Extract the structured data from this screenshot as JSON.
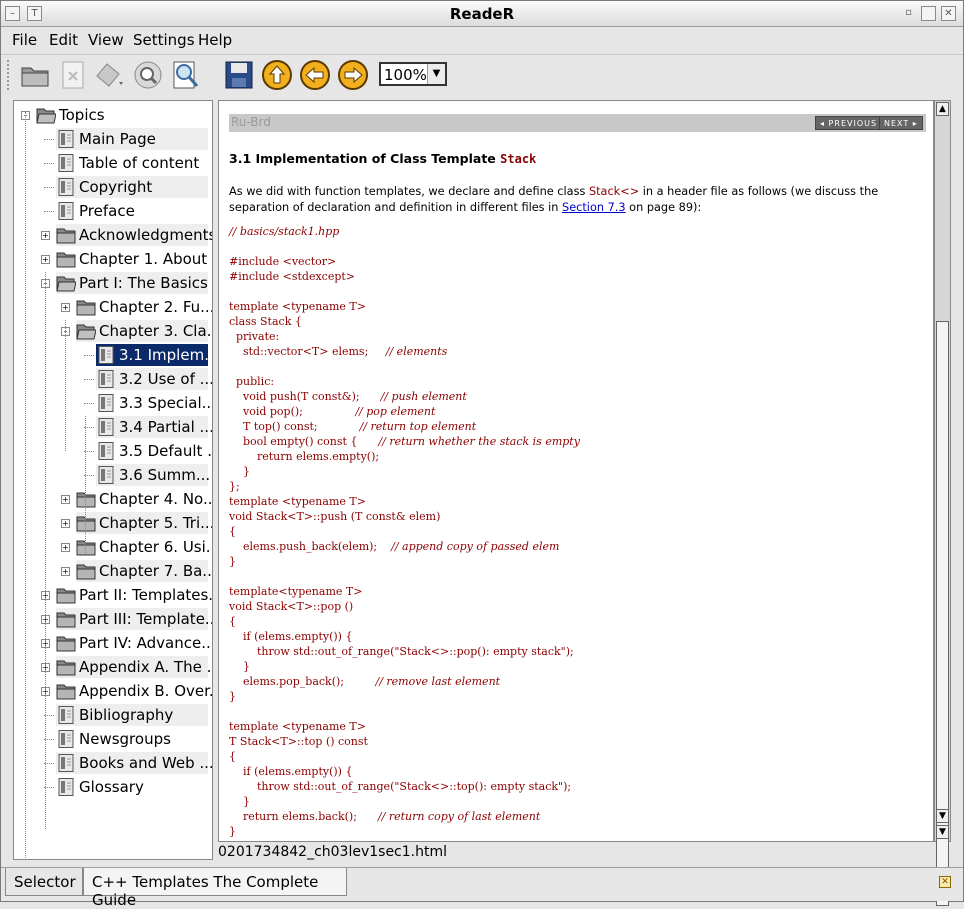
{
  "window": {
    "title": "ReadeR"
  },
  "menu": [
    "File",
    "Edit",
    "View",
    "Settings",
    "Help"
  ],
  "toolbar": {
    "zoom": "100%"
  },
  "tree": [
    {
      "label": "Topics",
      "depth": 0,
      "type": "folder-open",
      "exp": "-"
    },
    {
      "label": "Main Page",
      "depth": 1,
      "type": "doc"
    },
    {
      "label": "Table of content",
      "depth": 1,
      "type": "doc"
    },
    {
      "label": "Copyright",
      "depth": 1,
      "type": "doc"
    },
    {
      "label": "Preface",
      "depth": 1,
      "type": "doc"
    },
    {
      "label": "Acknowledgments",
      "depth": 1,
      "type": "folder",
      "exp": "+"
    },
    {
      "label": "Chapter 1. About ...",
      "depth": 1,
      "type": "folder",
      "exp": "+"
    },
    {
      "label": "Part I: The Basics",
      "depth": 1,
      "type": "folder-open",
      "exp": "-"
    },
    {
      "label": "Chapter 2. Fu...",
      "depth": 2,
      "type": "folder",
      "exp": "+"
    },
    {
      "label": "Chapter 3. Cla...",
      "depth": 2,
      "type": "folder-open",
      "exp": "-"
    },
    {
      "label": "3.1 Implem...",
      "depth": 3,
      "type": "doc",
      "selected": true
    },
    {
      "label": "3.2 Use of ...",
      "depth": 3,
      "type": "doc"
    },
    {
      "label": "3.3 Special...",
      "depth": 3,
      "type": "doc"
    },
    {
      "label": "3.4 Partial ...",
      "depth": 3,
      "type": "doc"
    },
    {
      "label": "3.5 Default ...",
      "depth": 3,
      "type": "doc"
    },
    {
      "label": "3.6 Summ...",
      "depth": 3,
      "type": "doc"
    },
    {
      "label": "Chapter 4. No...",
      "depth": 2,
      "type": "folder",
      "exp": "+"
    },
    {
      "label": "Chapter 5. Tri...",
      "depth": 2,
      "type": "folder",
      "exp": "+"
    },
    {
      "label": "Chapter 6. Usi...",
      "depth": 2,
      "type": "folder",
      "exp": "+"
    },
    {
      "label": "Chapter 7. Ba...",
      "depth": 2,
      "type": "folder",
      "exp": "+"
    },
    {
      "label": "Part II: Templates...",
      "depth": 1,
      "type": "folder",
      "exp": "+"
    },
    {
      "label": "Part III: Template...",
      "depth": 1,
      "type": "folder",
      "exp": "+"
    },
    {
      "label": "Part IV: Advance...",
      "depth": 1,
      "type": "folder",
      "exp": "+"
    },
    {
      "label": "Appendix A. The ...",
      "depth": 1,
      "type": "folder",
      "exp": "+"
    },
    {
      "label": "Appendix B. Over...",
      "depth": 1,
      "type": "folder",
      "exp": "+"
    },
    {
      "label": "Bibliography",
      "depth": 1,
      "type": "doc"
    },
    {
      "label": "Newsgroups",
      "depth": 1,
      "type": "doc"
    },
    {
      "label": "Books and Web ...",
      "depth": 1,
      "type": "doc"
    },
    {
      "label": "Glossary",
      "depth": 1,
      "type": "doc"
    }
  ],
  "content": {
    "breadcrumb": "Ru-Brd",
    "prev": "◂ PREVIOUS",
    "next": "NEXT ▸",
    "heading": "3.1 Implementation of Class Template",
    "heading_code": "Stack",
    "para_1": "As we did with function templates, we declare and define class",
    "para_code": "Stack<>",
    "para_2": "in a header file as follows (we discuss the separation of declaration and definition in different files in",
    "para_link": "Section 7.3",
    "para_3": "on page 89):",
    "code": [
      {
        "t": "",
        "c": "// basics/stack1.hpp"
      },
      {
        "t": "",
        "c": ""
      },
      {
        "t": "#include <vector>",
        "c": ""
      },
      {
        "t": "#include <stdexcept>",
        "c": ""
      },
      {
        "t": "",
        "c": ""
      },
      {
        "t": "template <typename T>",
        "c": ""
      },
      {
        "t": "class Stack {",
        "c": ""
      },
      {
        "t": "  private:",
        "c": ""
      },
      {
        "t": "    std::vector<T> elems;     ",
        "c": "// elements"
      },
      {
        "t": "",
        "c": ""
      },
      {
        "t": "  public:",
        "c": ""
      },
      {
        "t": "    void push(T const&);      ",
        "c": "// push element"
      },
      {
        "t": "    void pop();               ",
        "c": "// pop element"
      },
      {
        "t": "    T top() const;            ",
        "c": "// return top element"
      },
      {
        "t": "    bool empty() const {      ",
        "c": "// return whether the stack is empty"
      },
      {
        "t": "        return elems.empty();",
        "c": ""
      },
      {
        "t": "    }",
        "c": ""
      },
      {
        "t": "};",
        "c": ""
      },
      {
        "t": "template <typename T>",
        "c": ""
      },
      {
        "t": "void Stack<T>::push (T const& elem)",
        "c": ""
      },
      {
        "t": "{",
        "c": ""
      },
      {
        "t": "    elems.push_back(elem);    ",
        "c": "// append copy of passed elem"
      },
      {
        "t": "}",
        "c": ""
      },
      {
        "t": "",
        "c": ""
      },
      {
        "t": "template<typename T>",
        "c": ""
      },
      {
        "t": "void Stack<T>::pop ()",
        "c": ""
      },
      {
        "t": "{",
        "c": ""
      },
      {
        "t": "    if (elems.empty()) {",
        "c": ""
      },
      {
        "t": "        throw std::out_of_range(\"Stack<>::pop(): empty stack\");",
        "c": ""
      },
      {
        "t": "    }",
        "c": ""
      },
      {
        "t": "    elems.pop_back();         ",
        "c": "// remove last element"
      },
      {
        "t": "}",
        "c": ""
      },
      {
        "t": "",
        "c": ""
      },
      {
        "t": "template <typename T>",
        "c": ""
      },
      {
        "t": "T Stack<T>::top () const",
        "c": ""
      },
      {
        "t": "{",
        "c": ""
      },
      {
        "t": "    if (elems.empty()) {",
        "c": ""
      },
      {
        "t": "        throw std::out_of_range(\"Stack<>::top(): empty stack\");",
        "c": ""
      },
      {
        "t": "    }",
        "c": ""
      },
      {
        "t": "    return elems.back();      ",
        "c": "// return copy of last element"
      },
      {
        "t": "}",
        "c": ""
      }
    ]
  },
  "status": "0201734842_ch03lev1sec1.html",
  "tabs": [
    "Selector",
    "C++ Templates The Complete Guide"
  ]
}
